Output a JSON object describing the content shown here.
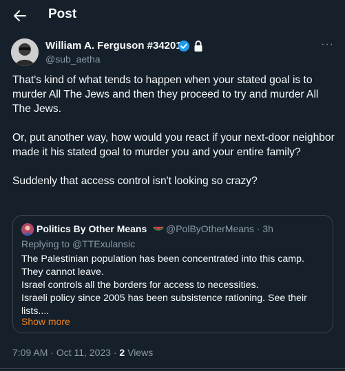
{
  "header": {
    "title": "Post",
    "back_icon": "arrow-left-icon"
  },
  "tweet": {
    "author_name": "William A. Ferguson #34201",
    "handle": "@sub_aetha",
    "verified_color": "#1d9bf0",
    "paragraphs": [
      "That's kind of what tends to happen when your stated goal is to murder All The Jews and then they proceed to try and murder All The Jews.",
      "Or, put another way, how would you react if your next-door neighbor made it his stated goal to murder you and your entire family?",
      "Suddenly that access control isn't looking so crazy?"
    ],
    "more_label": "···"
  },
  "quote": {
    "author_name": "Politics By Other Means",
    "emoji": "watermelon-icon",
    "handle": "@PolByOtherMeans",
    "separator": "·",
    "time": "3h",
    "replying_prefix": "Replying to",
    "replying_to": "@TTExulansic",
    "lines": [
      "The Palestinian population has been concentrated into this camp.",
      "They cannot leave.",
      "Israel controls all the borders for access to necessities.",
      "Israeli policy since 2005 has been subsistence rationing. See their",
      "lists...."
    ],
    "show_more": "Show more"
  },
  "footer": {
    "time": "7:09 AM",
    "date": "Oct 11, 2023",
    "separator": "·",
    "view_count": "2",
    "views_label": "Views"
  }
}
